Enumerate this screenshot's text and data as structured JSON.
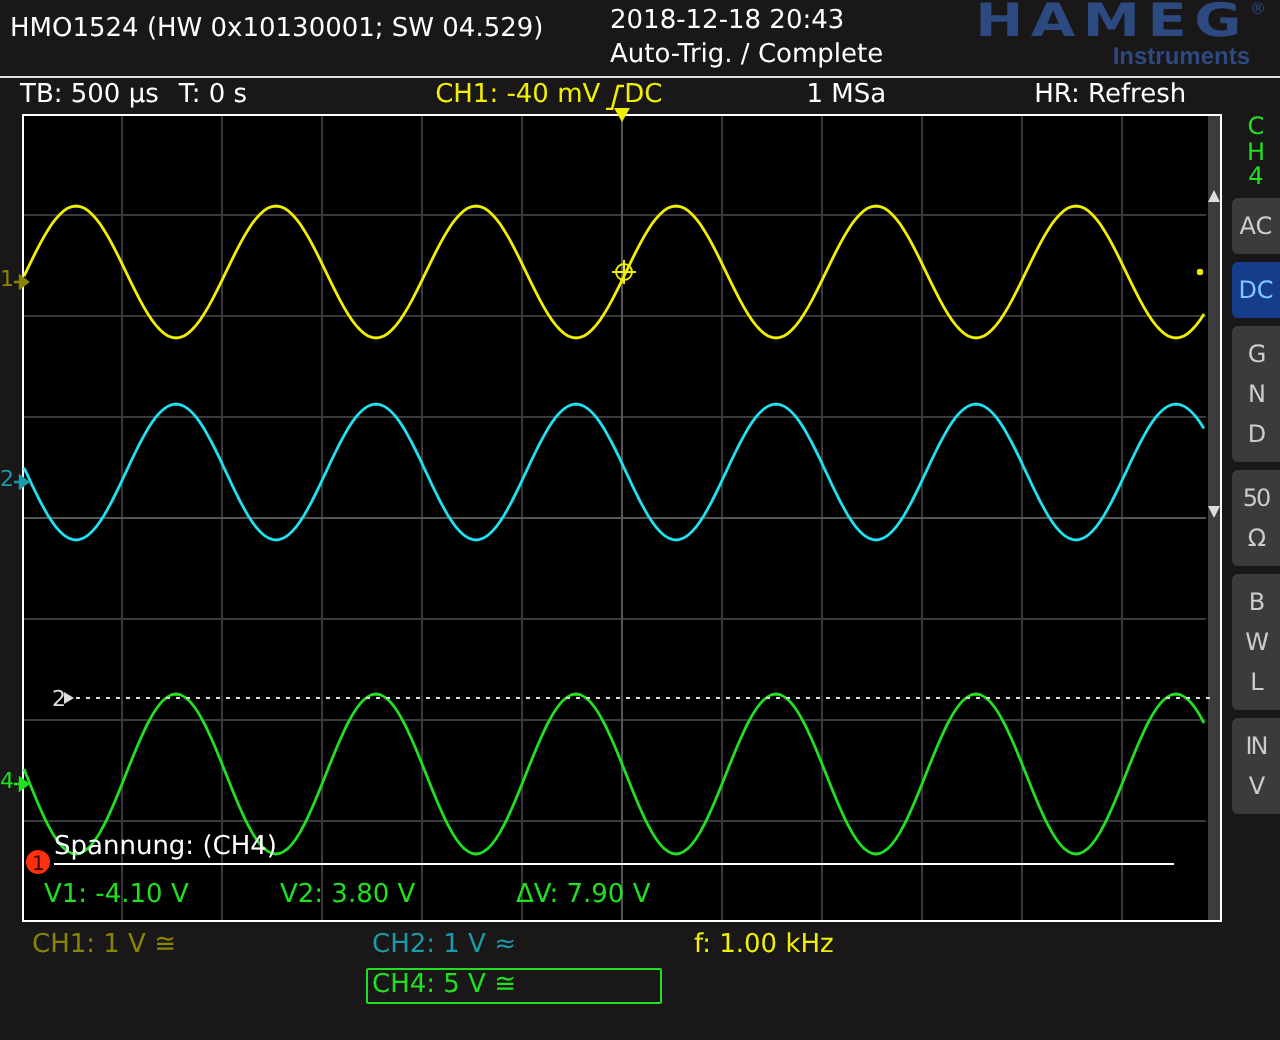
{
  "header": {
    "device": "HMO1524 (HW 0x10130001; SW 04.529)",
    "datetime": "2018-12-18 20:43",
    "status": "Auto-Trig. / Complete",
    "logo": "HAMEG",
    "logo_mark": "®",
    "logo_sub": "Instruments"
  },
  "info_bar": {
    "timebase": "TB: 500 µs",
    "time_offset": "T: 0 s",
    "trigger_level": "CH1: -40 mV",
    "trigger_coupling": "DC",
    "sample_rate": "1 MSa",
    "mode": "HR: Refresh"
  },
  "side_menu": {
    "title": "CH4",
    "buttons": [
      {
        "label": "AC",
        "kind": "inline",
        "selected": false
      },
      {
        "label": "DC",
        "kind": "inline",
        "selected": true
      },
      {
        "label": "GND",
        "kind": "stacked",
        "selected": false
      },
      {
        "label": "50 Ω",
        "kind": "stacked",
        "selected": false
      },
      {
        "label": "BWL",
        "kind": "stacked",
        "selected": false
      },
      {
        "label": "INV",
        "kind": "stacked",
        "selected": false
      }
    ]
  },
  "traces": [
    {
      "color": "#f0f000"
    },
    {
      "color": "#20e0f0"
    },
    {
      "color": "#20e020"
    }
  ],
  "channel_markers": [
    {
      "label": "1",
      "color": "#8a8400"
    },
    {
      "label": "2",
      "color": "#1a9aa8"
    },
    {
      "label": "4",
      "color": "#20e020"
    }
  ],
  "reference_marker": "2",
  "cursor": {
    "marker": "1",
    "title": "Spannung: (CH4)",
    "readings": [
      "V1: -4.10 V",
      "V2: 3.80 V",
      "ΔV: 7.90 V"
    ]
  },
  "channels": [
    {
      "label": "CH1: 1 V ≅",
      "color": "#8a8400",
      "selected": false
    },
    {
      "label": "CH2: 1 V ≈",
      "color": "#1a9aa8",
      "selected": false
    },
    {
      "label": "CH4: 5 V ≅",
      "color": "#20e020",
      "selected": true
    }
  ],
  "frequency": "f: 1.00 kHz"
}
